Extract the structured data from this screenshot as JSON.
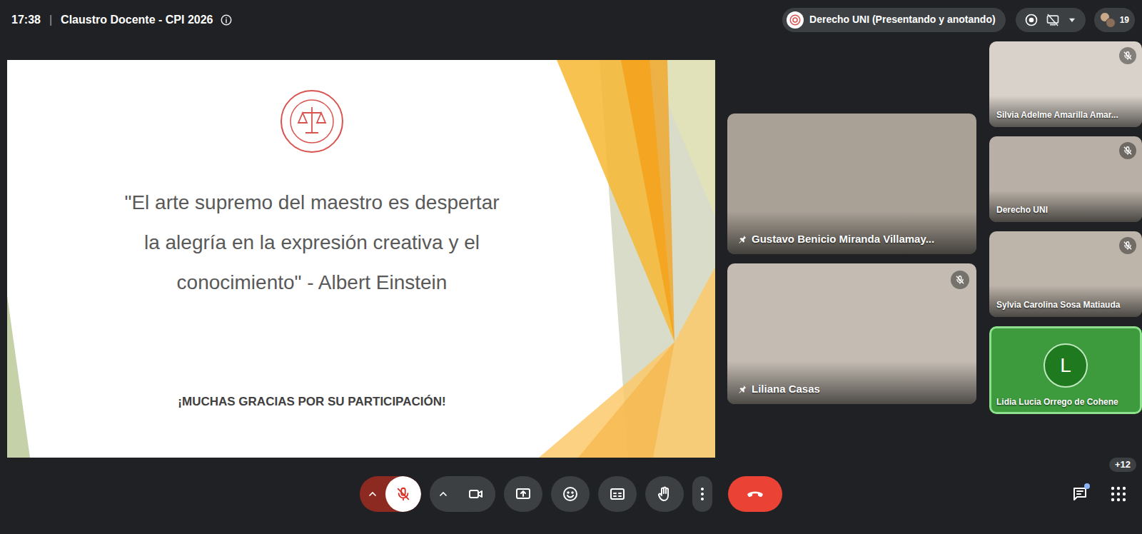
{
  "header": {
    "time": "17:38",
    "separator": "|",
    "title": "Claustro Docente - CPI 2026"
  },
  "presenter_chip": {
    "label": "Derecho UNI (Presentando y anotando)"
  },
  "recording": true,
  "participants_count": "19",
  "slide": {
    "quote_lines": [
      "\"El arte supremo del maestro es despertar",
      "la alegría en la expresión creativa y el",
      "conocimiento\" - Albert Einstein"
    ],
    "thanks": "¡MUCHAS GRACIAS POR SU PARTICIPACIÓN!"
  },
  "pinned_tiles": [
    {
      "name": "Gustavo Benicio Miranda Villamay...",
      "pinned": true,
      "muted": false
    },
    {
      "name": "Liliana Casas",
      "pinned": true,
      "muted": true
    }
  ],
  "side_tiles": [
    {
      "name": "Silvia Adelme Amarilla Amar...",
      "kind": "video",
      "muted": true,
      "speaking": false
    },
    {
      "name": "Derecho UNI",
      "kind": "video",
      "muted": true,
      "speaking": false
    },
    {
      "name": "Sylvia Carolina Sosa Matiauda",
      "kind": "video",
      "muted": true,
      "speaking": false
    },
    {
      "name": "Lidia Lucia Orrego de Cohene",
      "kind": "avatar",
      "initial": "L",
      "muted": false,
      "speaking": true
    }
  ],
  "more_participants": "+12",
  "toolbar": {
    "mic_muted": true,
    "camera_on": true,
    "chat_unread": true
  }
}
